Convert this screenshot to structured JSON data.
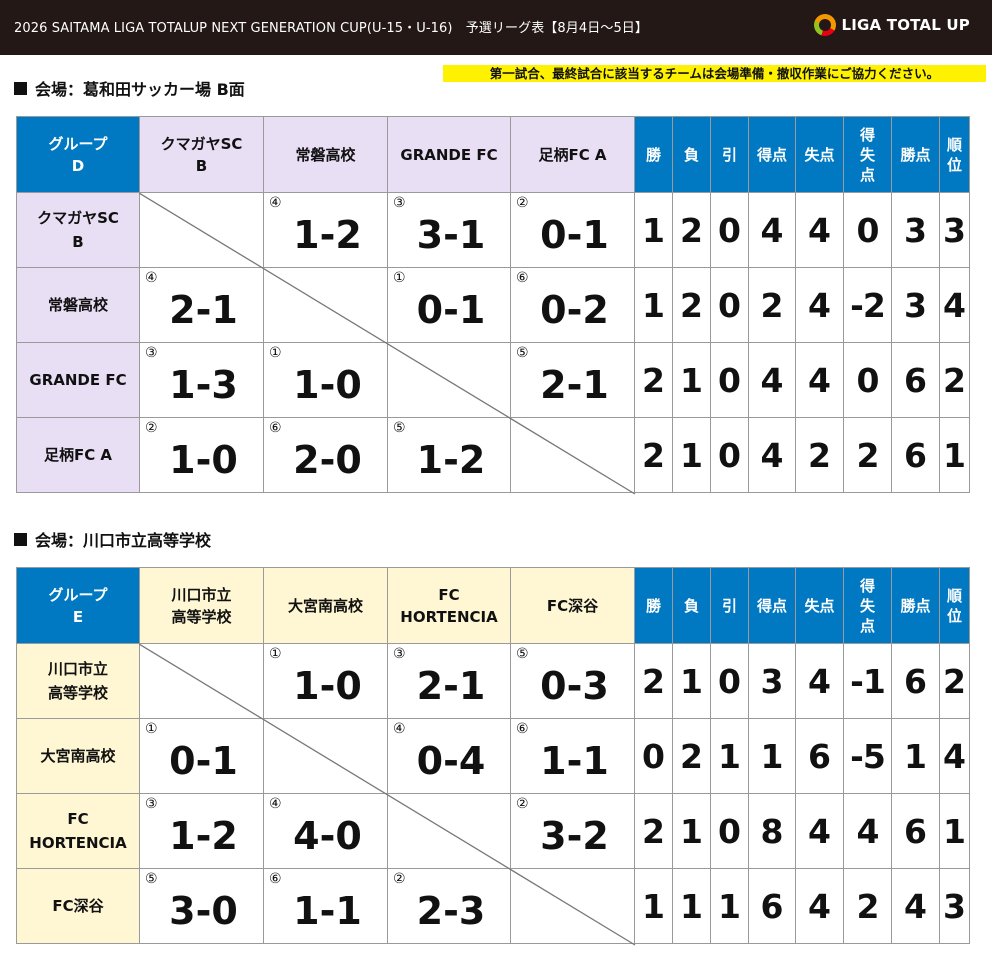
{
  "header": {
    "title": "2026 SAITAMA LIGA TOTALUP NEXT GENERATION CUP(U-15・U-16)　予選リーグ表【8月4日〜5日】",
    "logo_text": "LIGA TOTAL UP"
  },
  "notice": "第一試合、最終試合に該当するチームは会場準備・撤収作業にご協力ください。",
  "stat_headers": [
    "勝",
    "負",
    "引",
    "得点",
    "失点",
    "得失点",
    "勝点",
    "順位"
  ],
  "groups": [
    {
      "venue": "会場：葛和田サッカー場 B面",
      "group_label": [
        "グループ",
        "D"
      ],
      "teams": [
        [
          "クマガヤSC",
          "B"
        ],
        [
          "常磐高校"
        ],
        [
          "GRANDE FC"
        ],
        [
          "足柄FC A"
        ]
      ],
      "results": [
        [
          null,
          {
            "n": "④",
            "s": "1-2"
          },
          {
            "n": "③",
            "s": "3-1"
          },
          {
            "n": "②",
            "s": "0-1"
          }
        ],
        [
          {
            "n": "④",
            "s": "2-1"
          },
          null,
          {
            "n": "①",
            "s": "0-1"
          },
          {
            "n": "⑥",
            "s": "0-2"
          }
        ],
        [
          {
            "n": "③",
            "s": "1-3"
          },
          {
            "n": "①",
            "s": "1-0"
          },
          null,
          {
            "n": "⑤",
            "s": "2-1"
          }
        ],
        [
          {
            "n": "②",
            "s": "1-0"
          },
          {
            "n": "⑥",
            "s": "2-0"
          },
          {
            "n": "⑤",
            "s": "1-2"
          },
          null
        ]
      ],
      "stats": [
        [
          "1",
          "2",
          "0",
          "4",
          "4",
          "0",
          "3",
          "3"
        ],
        [
          "1",
          "2",
          "0",
          "2",
          "4",
          "-2",
          "3",
          "4"
        ],
        [
          "2",
          "1",
          "0",
          "4",
          "4",
          "0",
          "6",
          "2"
        ],
        [
          "2",
          "1",
          "0",
          "4",
          "2",
          "2",
          "6",
          "1"
        ]
      ]
    },
    {
      "venue": "会場：川口市立高等学校",
      "group_label": [
        "グループ",
        "E"
      ],
      "teams": [
        [
          "川口市立",
          "高等学校"
        ],
        [
          "大宮南高校"
        ],
        [
          "FC",
          "HORTENCIA"
        ],
        [
          "FC深谷"
        ]
      ],
      "results": [
        [
          null,
          {
            "n": "①",
            "s": "1-0"
          },
          {
            "n": "③",
            "s": "2-1"
          },
          {
            "n": "⑤",
            "s": "0-3"
          }
        ],
        [
          {
            "n": "①",
            "s": "0-1"
          },
          null,
          {
            "n": "④",
            "s": "0-4"
          },
          {
            "n": "⑥",
            "s": "1-1"
          }
        ],
        [
          {
            "n": "③",
            "s": "1-2"
          },
          {
            "n": "④",
            "s": "4-0"
          },
          null,
          {
            "n": "②",
            "s": "3-2"
          }
        ],
        [
          {
            "n": "⑤",
            "s": "3-0"
          },
          {
            "n": "⑥",
            "s": "1-1"
          },
          {
            "n": "②",
            "s": "2-3"
          },
          null
        ]
      ],
      "stats": [
        [
          "2",
          "1",
          "0",
          "3",
          "4",
          "-1",
          "6",
          "2"
        ],
        [
          "0",
          "2",
          "1",
          "1",
          "6",
          "-5",
          "1",
          "4"
        ],
        [
          "2",
          "1",
          "0",
          "8",
          "4",
          "4",
          "6",
          "1"
        ],
        [
          "1",
          "1",
          "1",
          "6",
          "4",
          "2",
          "4",
          "3"
        ]
      ]
    }
  ]
}
